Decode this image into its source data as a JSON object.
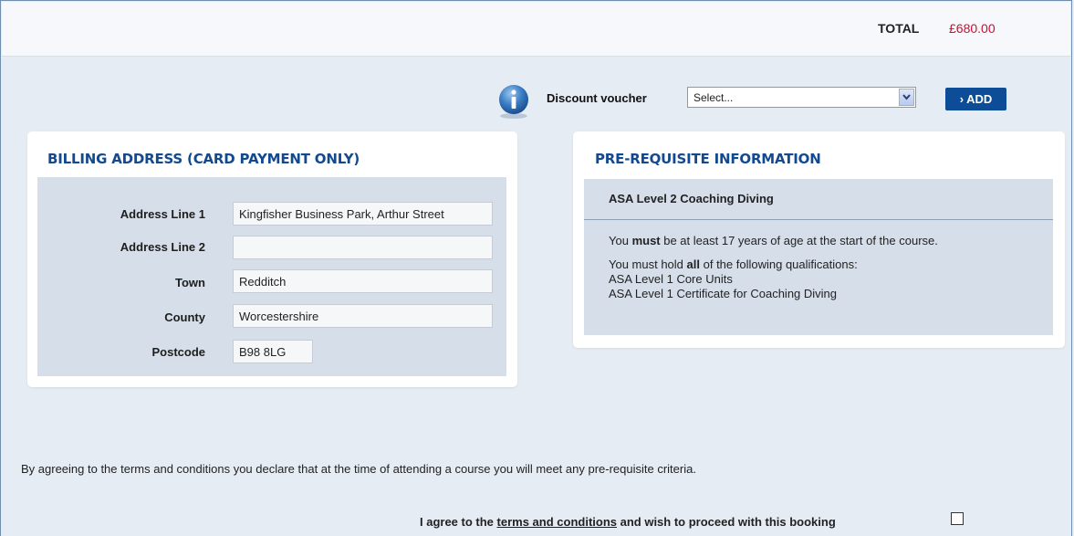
{
  "total": {
    "label": "TOTAL",
    "value": "£680.00"
  },
  "voucher": {
    "label": "Discount voucher",
    "selected": "Select...",
    "add_label": "› ADD"
  },
  "billing": {
    "title": "BILLING ADDRESS (CARD PAYMENT ONLY)",
    "fields": [
      {
        "label": "Address Line 1",
        "value": "Kingfisher Business Park, Arthur Street"
      },
      {
        "label": "Address Line 2",
        "value": ""
      },
      {
        "label": "Town",
        "value": "Redditch"
      },
      {
        "label": "County",
        "value": "Worcestershire"
      },
      {
        "label": "Postcode",
        "value": "B98 8LG"
      }
    ]
  },
  "prereq": {
    "title": "PRE-REQUISITE INFORMATION",
    "course": "ASA Level 2 Coaching Diving",
    "age_pre": "You ",
    "age_bold": "must",
    "age_post": " be at least 17 years of age at the start of the course.",
    "qual_pre": "You must hold ",
    "qual_bold": "all",
    "qual_post": " of the following qualifications:",
    "qualifications": [
      "ASA Level 1 Core Units",
      "ASA Level 1 Certificate for Coaching Diving"
    ]
  },
  "terms": {
    "declaration": "By agreeing to the terms and conditions you declare that at the time of attending a course you will meet any pre-requisite criteria.",
    "agree_pre": "I agree to the ",
    "agree_link": "terms and conditions",
    "agree_post": " and wish to proceed with this booking"
  },
  "colors": {
    "brand_blue": "#12498f",
    "button_blue": "#0d4c96",
    "total_red": "#c8102e"
  }
}
